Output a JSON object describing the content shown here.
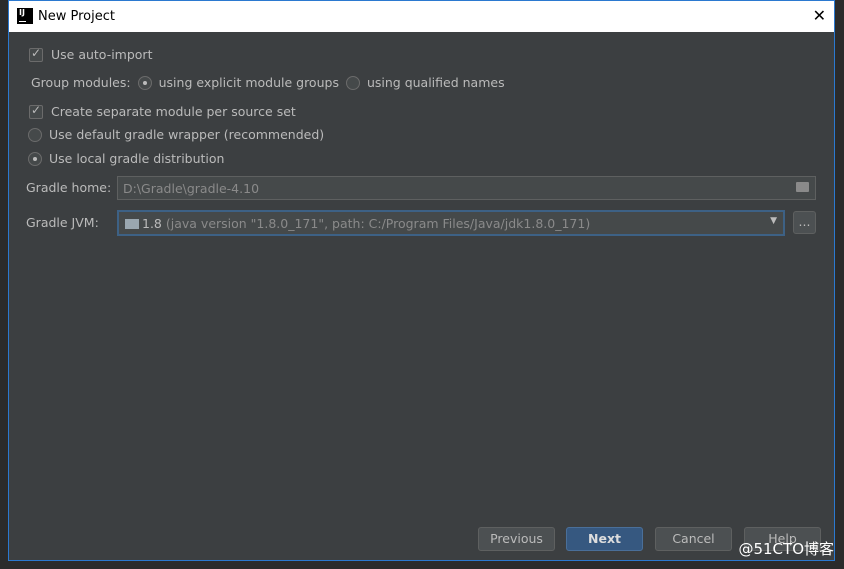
{
  "window": {
    "title": "New Project",
    "close": "✕"
  },
  "options": {
    "auto_import": "Use auto-import",
    "group_modules_label": "Group modules:",
    "group_explicit": "using explicit module groups",
    "group_qualified": "using qualified names",
    "separate_module": "Create separate module per source set",
    "default_wrapper": "Use default gradle wrapper (recommended)",
    "local_distribution": "Use local gradle distribution"
  },
  "gradle_home": {
    "label": "Gradle home:",
    "value": "D:\\Gradle\\gradle-4.10"
  },
  "gradle_jvm": {
    "label": "Gradle JVM:",
    "version": "1.8",
    "detail": "(java version \"1.8.0_171\", path: C:/Program Files/Java/jdk1.8.0_171)",
    "browse": "..."
  },
  "buttons": {
    "previous": "Previous",
    "next": "Next",
    "cancel": "Cancel",
    "help": "Help"
  },
  "watermark": "@51CTO博客",
  "colors": {
    "accent": "#365880",
    "focus": "#3d6185"
  }
}
